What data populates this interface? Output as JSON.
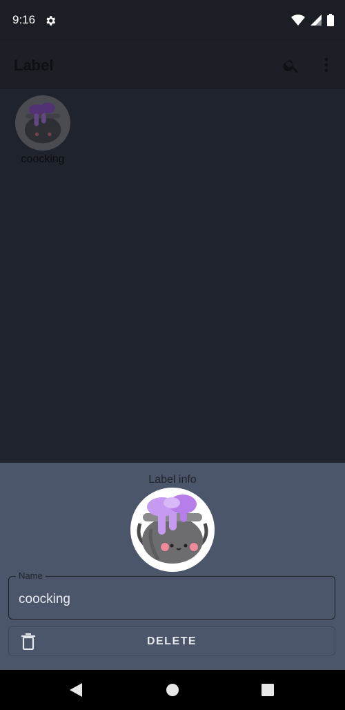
{
  "status_bar": {
    "time": "9:16",
    "icons": [
      "gear-icon",
      "wifi-icon",
      "signal-icon",
      "battery-icon"
    ]
  },
  "app_bar": {
    "title": "Label",
    "icons": [
      "search-icon",
      "more-vert-icon"
    ]
  },
  "grid": {
    "items": [
      {
        "label": "coocking",
        "icon": "cauldron-icon"
      }
    ]
  },
  "bottom_sheet": {
    "heading": "Label info",
    "avatar_icon": "cauldron-icon",
    "name_field": {
      "label": "Name",
      "value": "coocking"
    },
    "delete_button": {
      "label": "DELETE",
      "icon": "trash-icon"
    }
  },
  "nav_bar": {
    "icons": [
      "back-icon",
      "home-icon",
      "recents-icon"
    ]
  },
  "colors": {
    "scrim": "#1f232c",
    "sheet": "#4b566b",
    "cauldron_purple": "#b57ee8",
    "cauldron_gray": "#6d6d6f"
  }
}
